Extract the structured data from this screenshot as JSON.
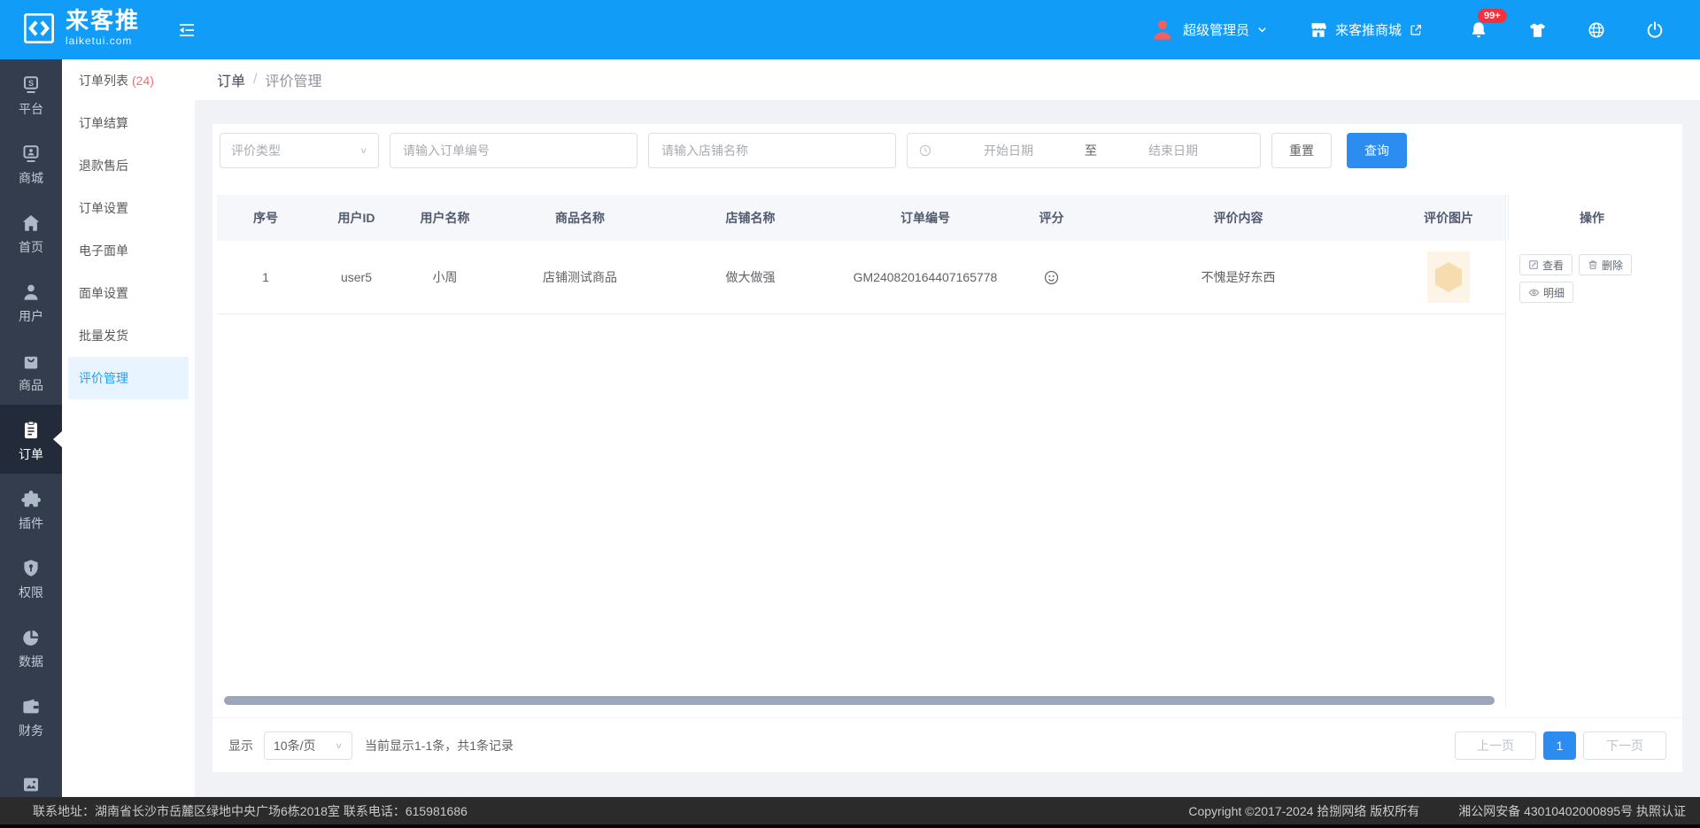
{
  "topbar": {
    "logo": {
      "title": "来客推",
      "subtitle": "laiketui.com",
      "icon": "code-brackets-icon"
    },
    "user": {
      "name": "超级管理员",
      "avatar_icon": "user-avatar-icon"
    },
    "mall_link": {
      "label": "来客推商城",
      "store_icon": "storefront-icon",
      "external_icon": "external-link-icon"
    },
    "notifications": {
      "badge": "99+",
      "icon": "bell-icon"
    },
    "quick_icons": [
      "tshirt-icon",
      "globe-icon",
      "power-icon"
    ]
  },
  "rail": {
    "items": [
      {
        "label": "平台",
        "icon": "platform-s-icon"
      },
      {
        "label": "商城",
        "icon": "mall-card-icon"
      },
      {
        "label": "首页",
        "icon": "home-icon"
      },
      {
        "label": "用户",
        "icon": "user-icon"
      },
      {
        "label": "商品",
        "icon": "shopping-bag-icon"
      },
      {
        "label": "订单",
        "icon": "clipboard-icon",
        "active": true
      },
      {
        "label": "插件",
        "icon": "puzzle-icon"
      },
      {
        "label": "权限",
        "icon": "shield-key-icon"
      },
      {
        "label": "数据",
        "icon": "pie-chart-icon"
      },
      {
        "label": "财务",
        "icon": "wallet-icon"
      },
      {
        "label": "",
        "icon": "picture-icon"
      }
    ]
  },
  "sidebar": {
    "items": [
      {
        "label": "订单列表",
        "count": "(24)"
      },
      {
        "label": "订单结算"
      },
      {
        "label": "退款售后"
      },
      {
        "label": "订单设置"
      },
      {
        "label": "电子面单"
      },
      {
        "label": "面单设置"
      },
      {
        "label": "批量发货"
      },
      {
        "label": "评价管理",
        "active": true
      }
    ]
  },
  "breadcrumb": {
    "section": "订单",
    "separator": "/",
    "current": "评价管理"
  },
  "filters": {
    "type_select": {
      "placeholder": "评价类型"
    },
    "order_input": {
      "placeholder": "请输入订单编号"
    },
    "shop_input": {
      "placeholder": "请输入店铺名称"
    },
    "date_range": {
      "icon": "clock-icon",
      "start_placeholder": "开始日期",
      "separator": "至",
      "end_placeholder": "结束日期"
    },
    "reset_label": "重置",
    "search_label": "查询"
  },
  "table": {
    "columns": [
      "序号",
      "用户ID",
      "用户名称",
      "商品名称",
      "店铺名称",
      "订单编号",
      "评分",
      "评价内容",
      "评价图片",
      "操作"
    ],
    "rows": [
      {
        "index": "1",
        "user_id": "user5",
        "user_name": "小周",
        "product": "店铺测试商品",
        "shop": "做大做强",
        "order_no": "GM240820164407165778",
        "rating_icon": "smiley-face-icon",
        "content": "不愧是好东西",
        "image": "review-thumbnail",
        "actions": [
          {
            "label": "查看",
            "icon": "edit-square-icon"
          },
          {
            "label": "删除",
            "icon": "trash-icon"
          },
          {
            "label": "明细",
            "icon": "eye-icon"
          }
        ]
      }
    ]
  },
  "pagination": {
    "show_label": "显示",
    "page_size": "10条/页",
    "summary": "当前显示1-1条，共1条记录",
    "prev_label": "上一页",
    "current_page": "1",
    "next_label": "下一页"
  },
  "footer": {
    "contact": "联系地址：湖南省长沙市岳麓区绿地中央广场6栋2018室 联系电话：615981686",
    "copyright": "Copyright ©2017-2024 拾捌网络 版权所有",
    "filing": "湘公网安备 43010402000895号 执照认证"
  },
  "colors": {
    "header_blue": "#119cf7",
    "primary_blue": "#2d8cf0",
    "active_link_blue": "#1e9fff",
    "badge_red": "#f5313d",
    "count_red": "#f56c6c",
    "rail_bg": "#333d4d",
    "rail_active_bg": "#232b3a",
    "footer_bg": "#2b2b2b"
  }
}
